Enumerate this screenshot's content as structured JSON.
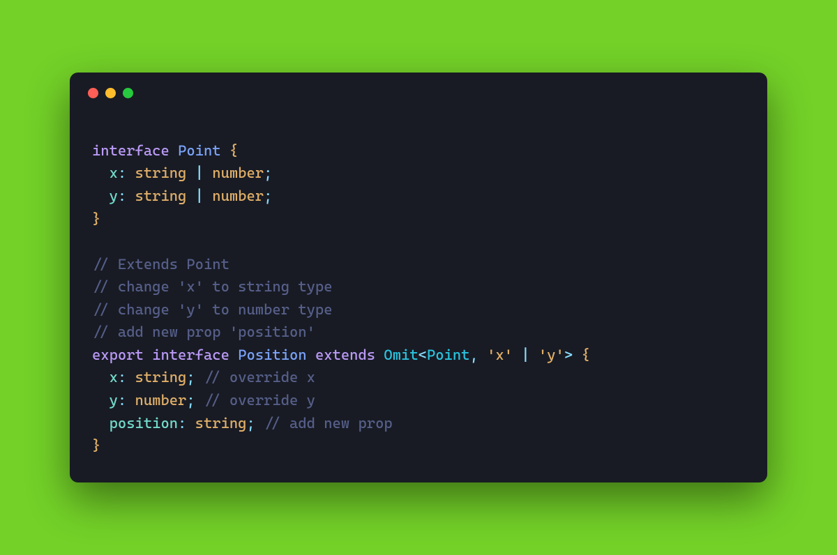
{
  "window": {
    "buttons": [
      "close",
      "minimize",
      "maximize"
    ]
  },
  "code": {
    "l1": {
      "kw": "interface",
      "type": "Point",
      "brace": "{"
    },
    "l2": {
      "indent": "  ",
      "prop": "x",
      "colon": ": ",
      "t1": "string",
      "sep": " | ",
      "t2": "number",
      "semi": ";"
    },
    "l3": {
      "indent": "  ",
      "prop": "y",
      "colon": ": ",
      "t1": "string",
      "sep": " | ",
      "t2": "number",
      "semi": ";"
    },
    "l4": {
      "brace": "}"
    },
    "l5": "",
    "l6": {
      "comment": "// Extends Point"
    },
    "l7": {
      "comment": "// change 'x' to string type"
    },
    "l8": {
      "comment": "// change 'y' to number type"
    },
    "l9": {
      "comment": "// add new prop 'position'"
    },
    "l10": {
      "kw1": "export",
      "kw2": "interface",
      "type": "Position",
      "kw3": "extends",
      "util": "Omit",
      "lt": "<",
      "ptype": "Point",
      "comma": ", ",
      "s1": "'x'",
      "sep": " | ",
      "s2": "'y'",
      "gt": ">",
      "brace": " {"
    },
    "l11": {
      "indent": "  ",
      "prop": "x",
      "colon": ": ",
      "t": "string",
      "semi": ";",
      "sp": " ",
      "comment": "// override x"
    },
    "l12": {
      "indent": "  ",
      "prop": "y",
      "colon": ": ",
      "t": "number",
      "semi": ";",
      "sp": " ",
      "comment": "// override y"
    },
    "l13": {
      "indent": "  ",
      "prop": "position",
      "colon": ": ",
      "t": "string",
      "semi": ";",
      "sp": " ",
      "comment": "// add new prop"
    },
    "l14": {
      "brace": "}"
    }
  }
}
